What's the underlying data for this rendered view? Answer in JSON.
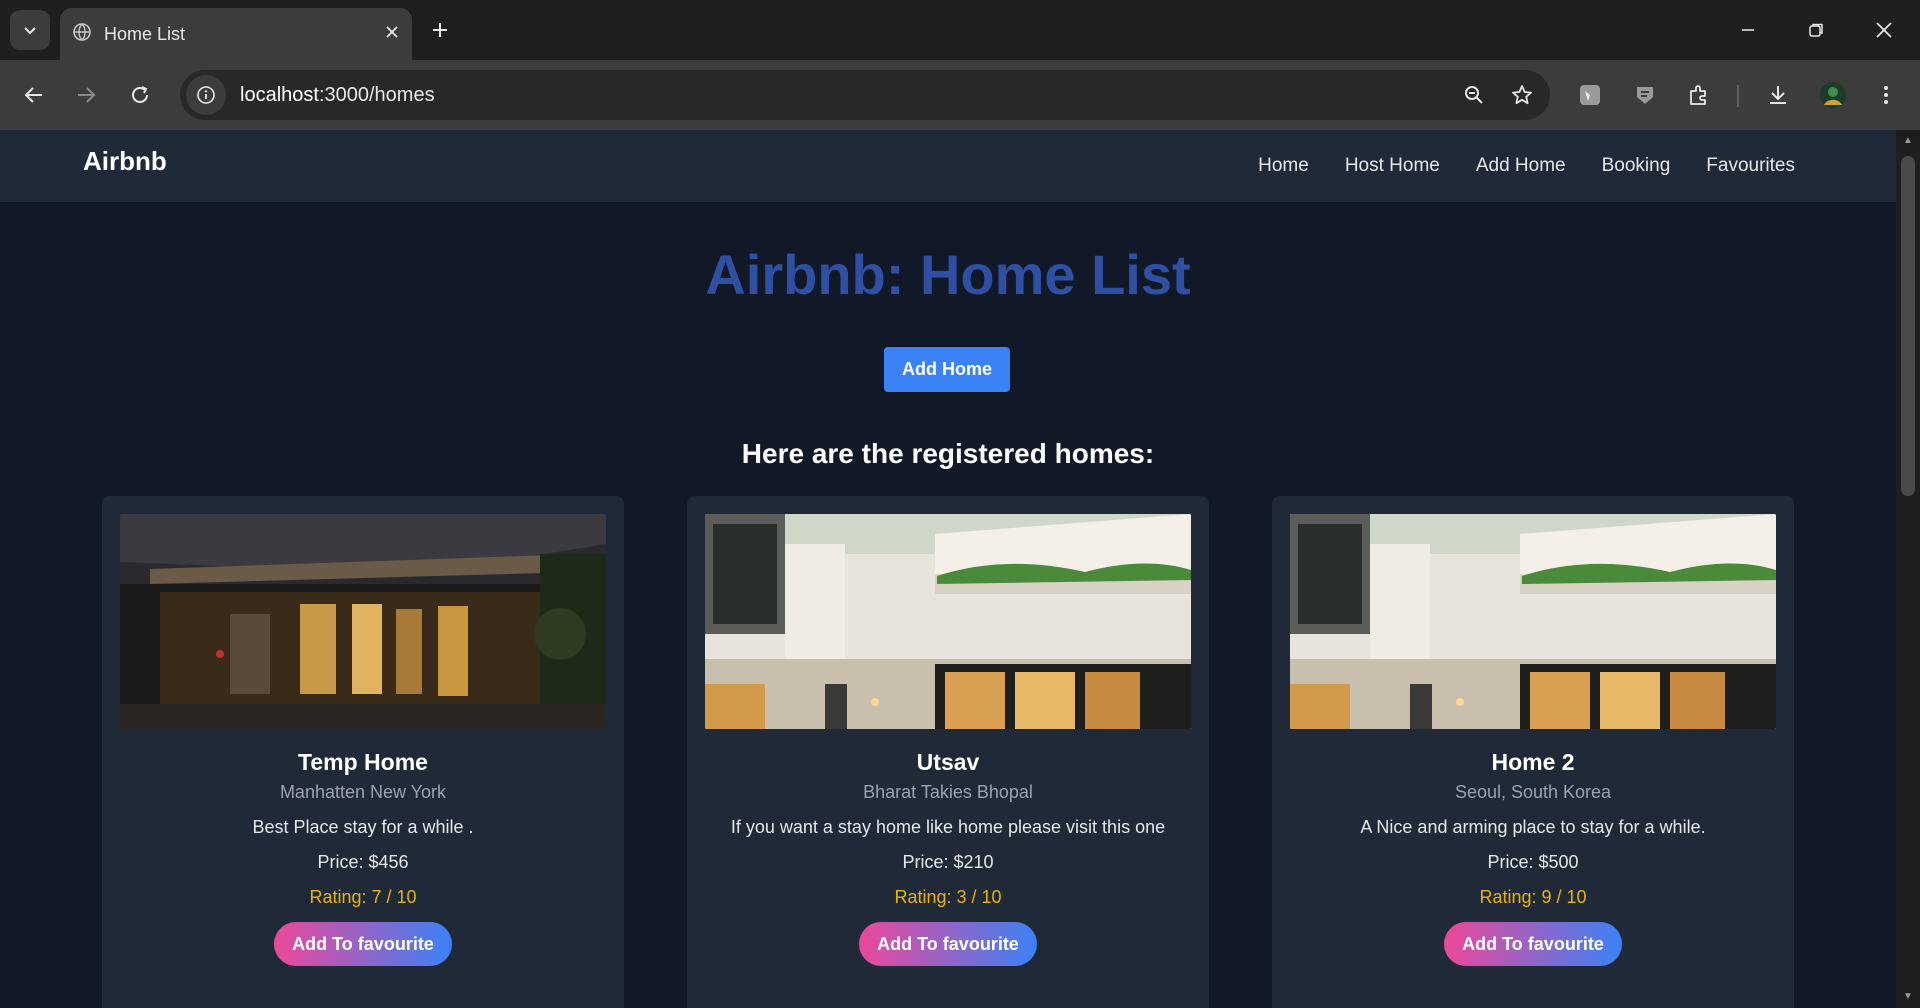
{
  "browser": {
    "tab_title": "Home List",
    "url_host": "localhost",
    "url_rest": ":3000/homes",
    "icons": [
      "tab-search-icon",
      "globe-icon",
      "close-icon",
      "plus-icon",
      "minimize-icon",
      "restore-icon",
      "window-close-icon",
      "back-icon",
      "forward-icon",
      "reload-icon",
      "site-info-icon",
      "zoom-icon",
      "star-icon",
      "extension-icon",
      "download-icon",
      "profile-icon",
      "menu-icon"
    ]
  },
  "nav": {
    "brand": "Airbnb",
    "links": [
      "Home",
      "Host Home",
      "Add Home",
      "Booking",
      "Favourites"
    ]
  },
  "main": {
    "heading": "Airbnb: Home List",
    "add_home_label": "Add Home",
    "subheading": "Here are the registered homes:"
  },
  "homes": [
    {
      "name": "Temp Home",
      "location": "Manhatten New York",
      "description": "Best Place stay for a while .",
      "price": "Price: $456",
      "rating": "Rating: 7 / 10",
      "button": "Add To favourite",
      "image": "hotel-entrance-night"
    },
    {
      "name": "Utsav",
      "location": "Bharat Takies Bhopal",
      "description": "If you want a stay home like home please visit this one",
      "price": "Price: $210",
      "rating": "Rating: 3 / 10",
      "button": "Add To favourite",
      "image": "modern-house"
    },
    {
      "name": "Home 2",
      "location": "Seoul, South Korea",
      "description": "A Nice and arming place to stay for a while.",
      "price": "Price: $500",
      "rating": "Rating: 9 / 10",
      "button": "Add To favourite",
      "image": "modern-house"
    }
  ],
  "colors": {
    "page_bg": "#111827",
    "nav_bg": "#1f2937",
    "heading": "#2f4fa2",
    "accent_blue": "#3b82f6",
    "accent_pink": "#ec4899",
    "rating": "#eab308"
  }
}
